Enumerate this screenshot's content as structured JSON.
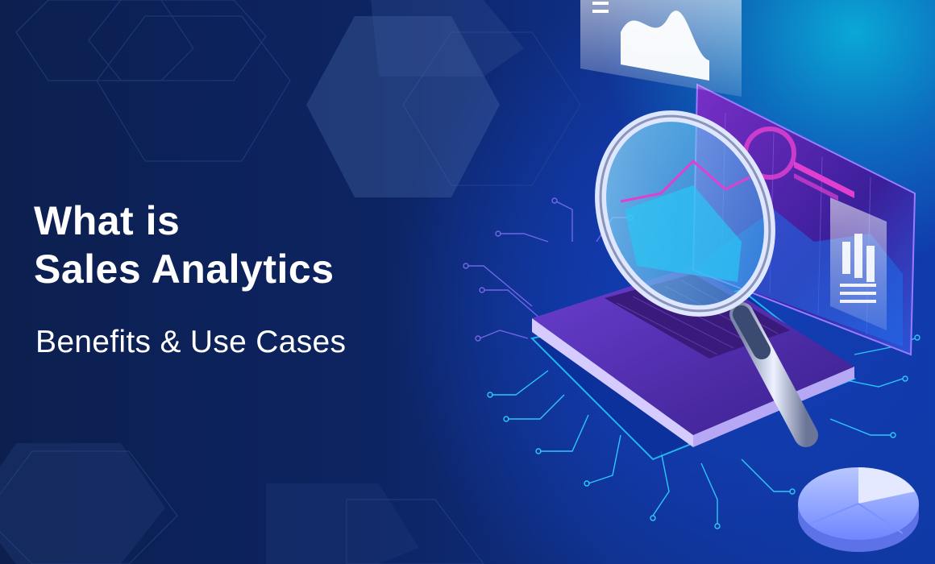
{
  "banner": {
    "title_line_1": "What is",
    "title_line_2": "Sales Analytics",
    "subtitle": "Benefits & Use Cases"
  },
  "colors": {
    "background_dark": "#0c1f4f",
    "background_blue": "#0f3aa5",
    "accent_cyan": "#19c8f0",
    "laptop_purple": "#4b2aa6",
    "screen_magenta": "#e03fd0",
    "text": "#ffffff"
  },
  "icons": [
    "magnifying-glass-icon",
    "laptop-icon",
    "pie-chart-icon",
    "bar-chart-icon",
    "area-chart-icon",
    "circuit-lines-icon"
  ]
}
